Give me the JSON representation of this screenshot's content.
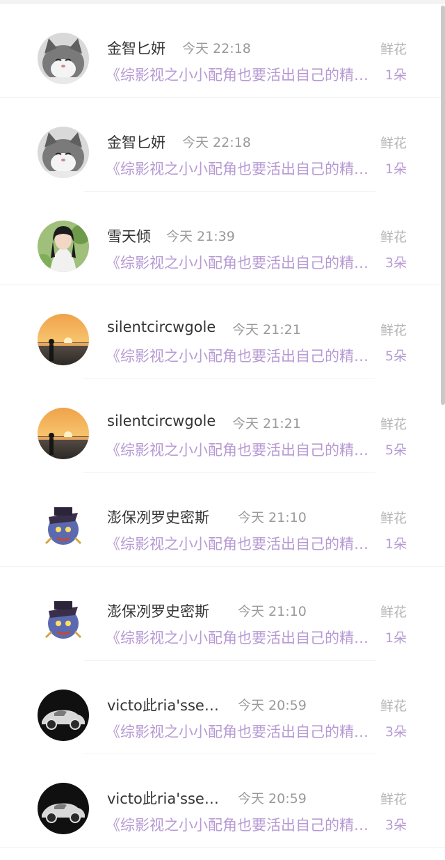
{
  "messages": [
    {
      "user": "金智匕妍",
      "time": "今天 22:18",
      "book": "《综影视之小小配角也要活出自己的精彩》",
      "gift_type": "鲜花",
      "gift_count": "1朵",
      "avatar": "cat-avatar"
    },
    {
      "user": "金智匕妍",
      "time": "今天 22:18",
      "book": "《综影视之小小配角也要活出自己的精彩》",
      "gift_type": "鲜花",
      "gift_count": "1朵",
      "avatar": "cat-avatar"
    },
    {
      "user": "雪天倾",
      "time": "今天 21:39",
      "book": "《综影视之小小配角也要活出自己的精彩》",
      "gift_type": "鲜花",
      "gift_count": "3朵",
      "avatar": "girl-avatar"
    },
    {
      "user": "silentcircwgole",
      "time": "今天 21:21",
      "book": "《综影视之小小配角也要活出自己的精彩》",
      "gift_type": "鲜花",
      "gift_count": "5朵",
      "avatar": "sunset-avatar"
    },
    {
      "user": "silentcircwgole",
      "time": "今天 21:21",
      "book": "《综影视之小小配角也要活出自己的精彩》",
      "gift_type": "鲜花",
      "gift_count": "5朵",
      "avatar": "sunset-avatar"
    },
    {
      "user": "澎保冽罗史密斯",
      "time": "今天 21:10",
      "book": "《综影视之小小配角也要活出自己的精彩》",
      "gift_type": "鲜花",
      "gift_count": "1朵",
      "avatar": "cartoon-avatar"
    },
    {
      "user": "澎保冽罗史密斯",
      "time": "今天 21:10",
      "book": "《综影视之小小配角也要活出自己的精彩》",
      "gift_type": "鲜花",
      "gift_count": "1朵",
      "avatar": "cartoon-avatar"
    },
    {
      "user": "victo此ria'ssecret",
      "time": "今天 20:59",
      "book": "《综影视之小小配角也要活出自己的精彩》",
      "gift_type": "鲜花",
      "gift_count": "3朵",
      "avatar": "car-avatar"
    },
    {
      "user": "victo此ria'ssecret",
      "time": "今天 20:59",
      "book": "《综影视之小小配角也要活出自己的精彩》",
      "gift_type": "鲜花",
      "gift_count": "3朵",
      "avatar": "car-avatar"
    }
  ]
}
